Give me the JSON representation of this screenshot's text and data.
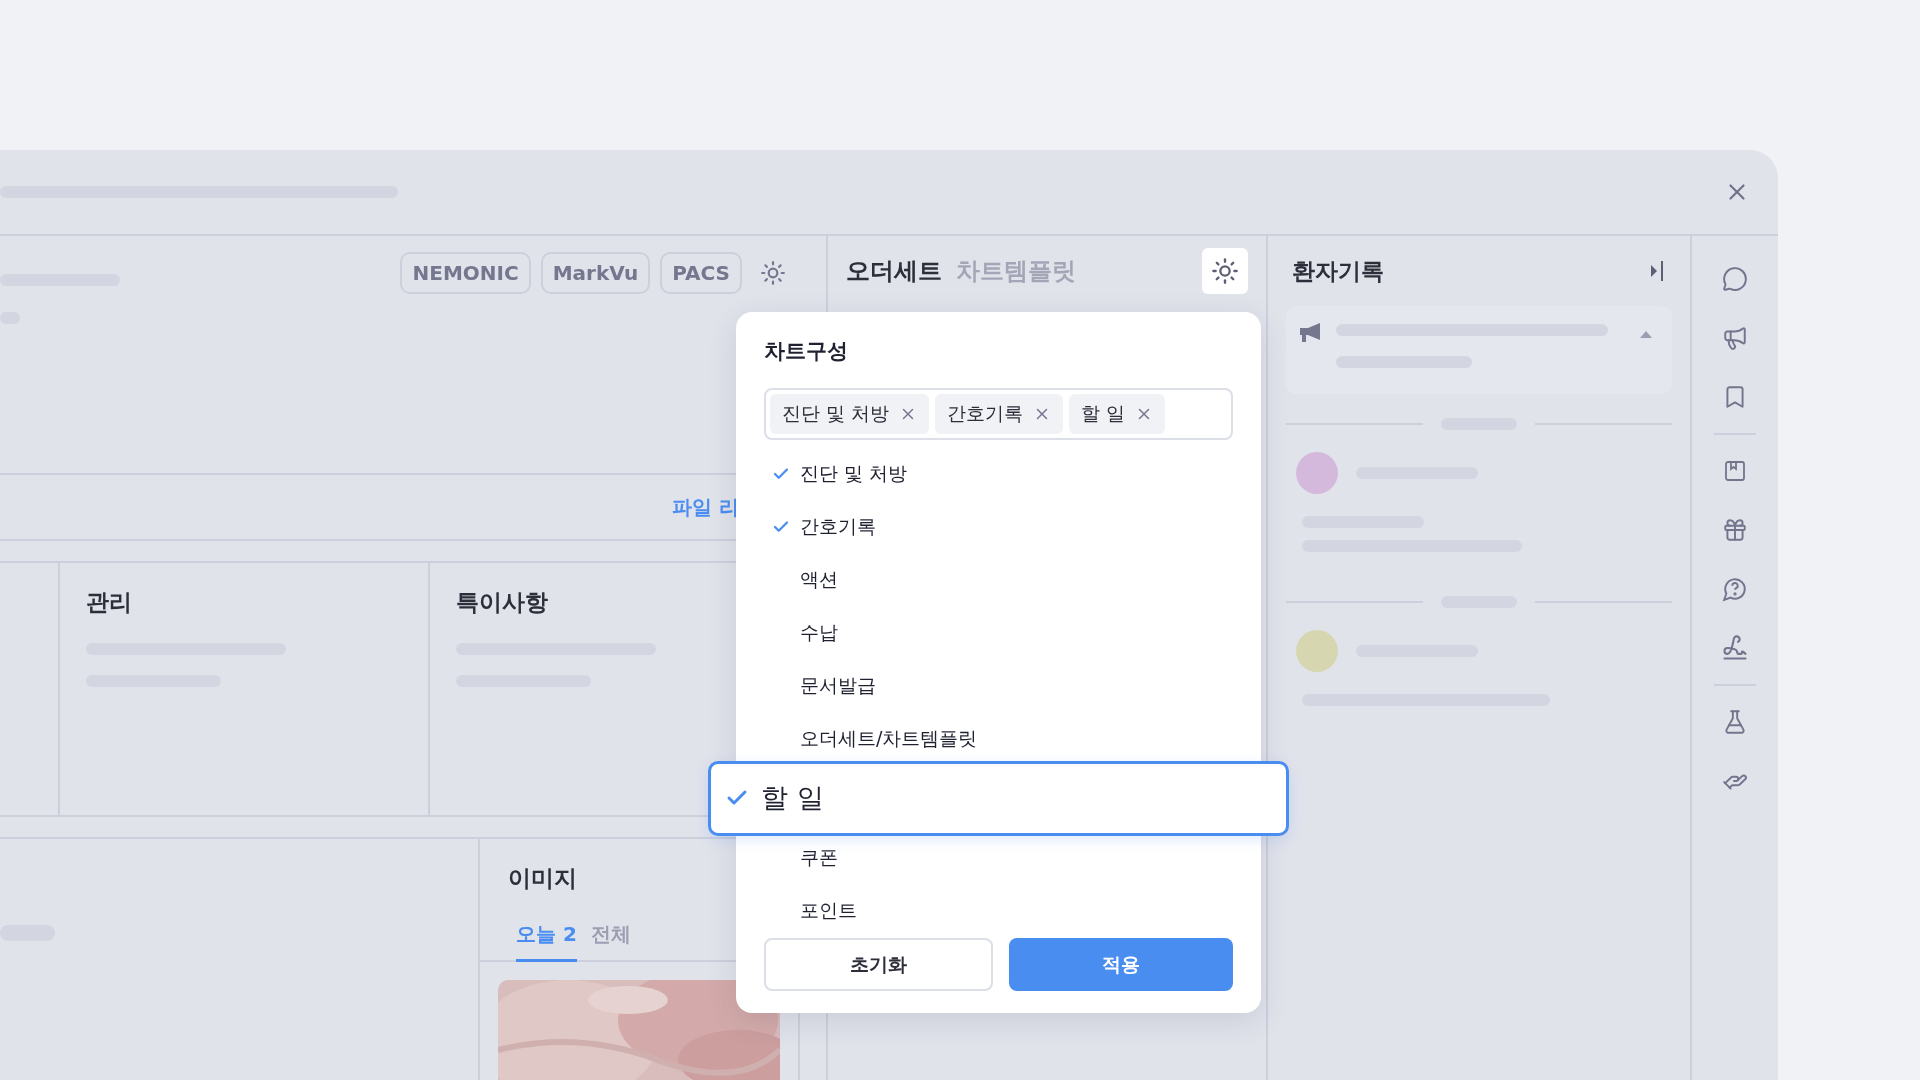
{
  "toolbar_buttons": [
    "NEMONIC",
    "MarkVu",
    "PACS"
  ],
  "file_link": "파일 리",
  "cards": [
    {
      "title": "관리"
    },
    {
      "title": "특이사항"
    }
  ],
  "image_panel": {
    "title": "이미지",
    "tabs": [
      {
        "label": "오늘 2",
        "selected": true
      },
      {
        "label": "전체",
        "selected": false
      }
    ]
  },
  "order_panel": {
    "tabs": [
      {
        "label": "오더세트",
        "selected": true
      },
      {
        "label": "차트템플릿",
        "selected": false
      }
    ]
  },
  "patient_panel": {
    "title": "환자기록",
    "entries": [
      {
        "color": "#d4b9dd"
      },
      {
        "color": "#d6d7b1"
      }
    ]
  },
  "popover": {
    "title": "차트구성",
    "tags": [
      "진단 및 처방",
      "간호기록",
      "할 일"
    ],
    "options": [
      {
        "label": "진단 및 처방",
        "checked": true,
        "dragging": false
      },
      {
        "label": "간호기록",
        "checked": true,
        "dragging": false
      },
      {
        "label": "액션",
        "checked": false,
        "dragging": false
      },
      {
        "label": "수납",
        "checked": false,
        "dragging": false
      },
      {
        "label": "문서발급",
        "checked": false,
        "dragging": false
      },
      {
        "label": "오더세트/차트템플릿",
        "checked": false,
        "dragging": false
      },
      {
        "label": "할 일",
        "checked": true,
        "dragging": true
      },
      {
        "label": "쿠폰",
        "checked": false,
        "dragging": false
      },
      {
        "label": "포인트",
        "checked": false,
        "dragging": false
      }
    ],
    "buttons": [
      {
        "label": "초기화",
        "kind": "secondary"
      },
      {
        "label": "적용",
        "kind": "primary"
      }
    ]
  }
}
